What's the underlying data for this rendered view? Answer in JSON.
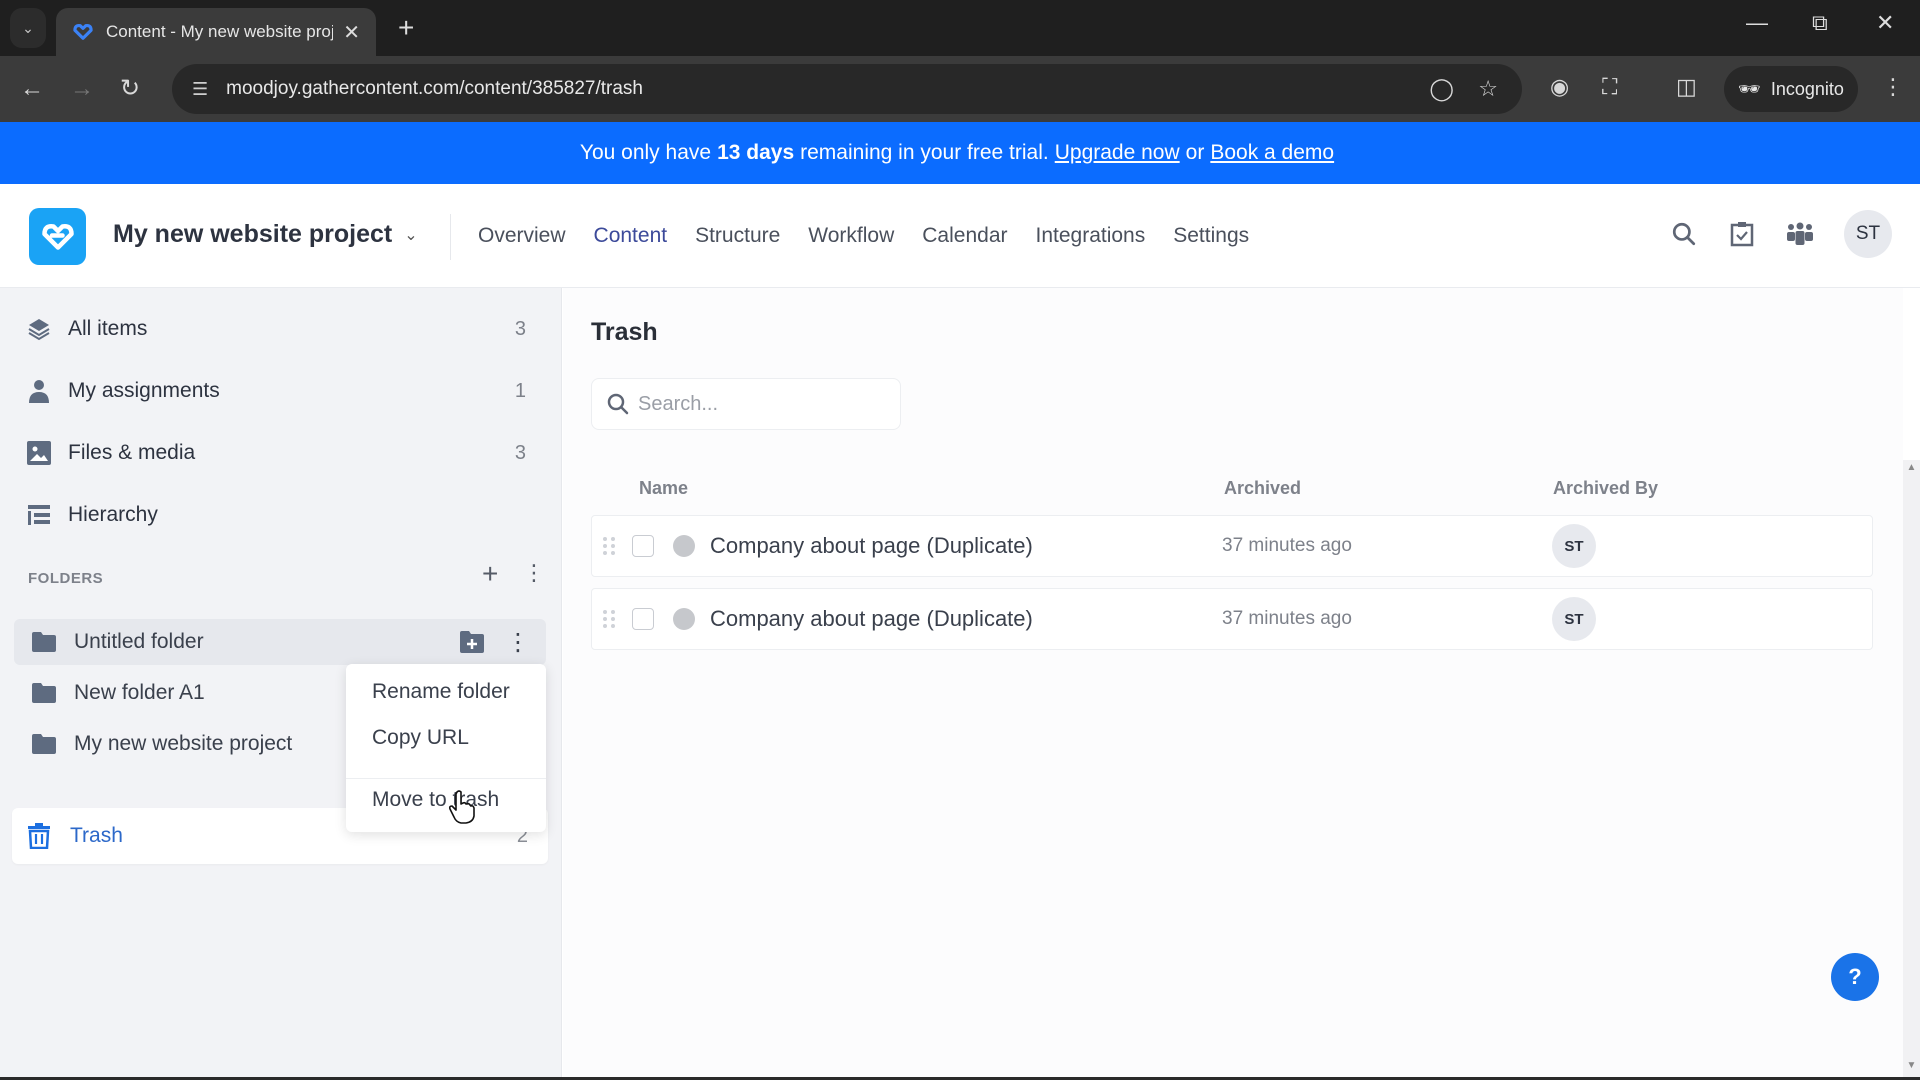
{
  "browser": {
    "tab_title": "Content - My new website proj",
    "url": "moodjoy.gathercontent.com/content/385827/trash",
    "incognito_label": "Incognito"
  },
  "banner": {
    "prefix": "You only have",
    "days": "13 days",
    "suffix": "remaining in your free trial.",
    "upgrade_link": "Upgrade now",
    "or": "or",
    "demo_link": "Book a demo",
    "color": "#0b6cff"
  },
  "header": {
    "project_name": "My new website project",
    "nav": [
      {
        "label": "Overview",
        "active": false
      },
      {
        "label": "Content",
        "active": true
      },
      {
        "label": "Structure",
        "active": false
      },
      {
        "label": "Workflow",
        "active": false
      },
      {
        "label": "Calendar",
        "active": false
      },
      {
        "label": "Integrations",
        "active": false
      },
      {
        "label": "Settings",
        "active": false
      }
    ],
    "user_initials": "ST"
  },
  "sidebar": {
    "items": [
      {
        "label": "All items",
        "count": "3",
        "icon": "layers-icon"
      },
      {
        "label": "My assignments",
        "count": "1",
        "icon": "user-icon"
      },
      {
        "label": "Files & media",
        "count": "3",
        "icon": "image-icon"
      },
      {
        "label": "Hierarchy",
        "count": "",
        "icon": "hierarchy-icon"
      }
    ],
    "folders_heading": "FOLDERS",
    "folders": [
      {
        "label": "Untitled folder",
        "selected": true
      },
      {
        "label": "New folder A1",
        "selected": false
      },
      {
        "label": "My new website project",
        "selected": false
      }
    ],
    "trash": {
      "label": "Trash",
      "count": "2"
    }
  },
  "context_menu": {
    "items": [
      "Rename folder",
      "Copy URL",
      "Move to trash"
    ]
  },
  "main": {
    "title": "Trash",
    "search_placeholder": "Search...",
    "columns": [
      "Name",
      "Archived",
      "Archived By"
    ],
    "rows": [
      {
        "name": "Company about page (Duplicate)",
        "archived": "37 minutes ago",
        "archived_by": "ST"
      },
      {
        "name": "Company about page (Duplicate)",
        "archived": "37 minutes ago",
        "archived_by": "ST"
      }
    ]
  },
  "help_label": "?"
}
